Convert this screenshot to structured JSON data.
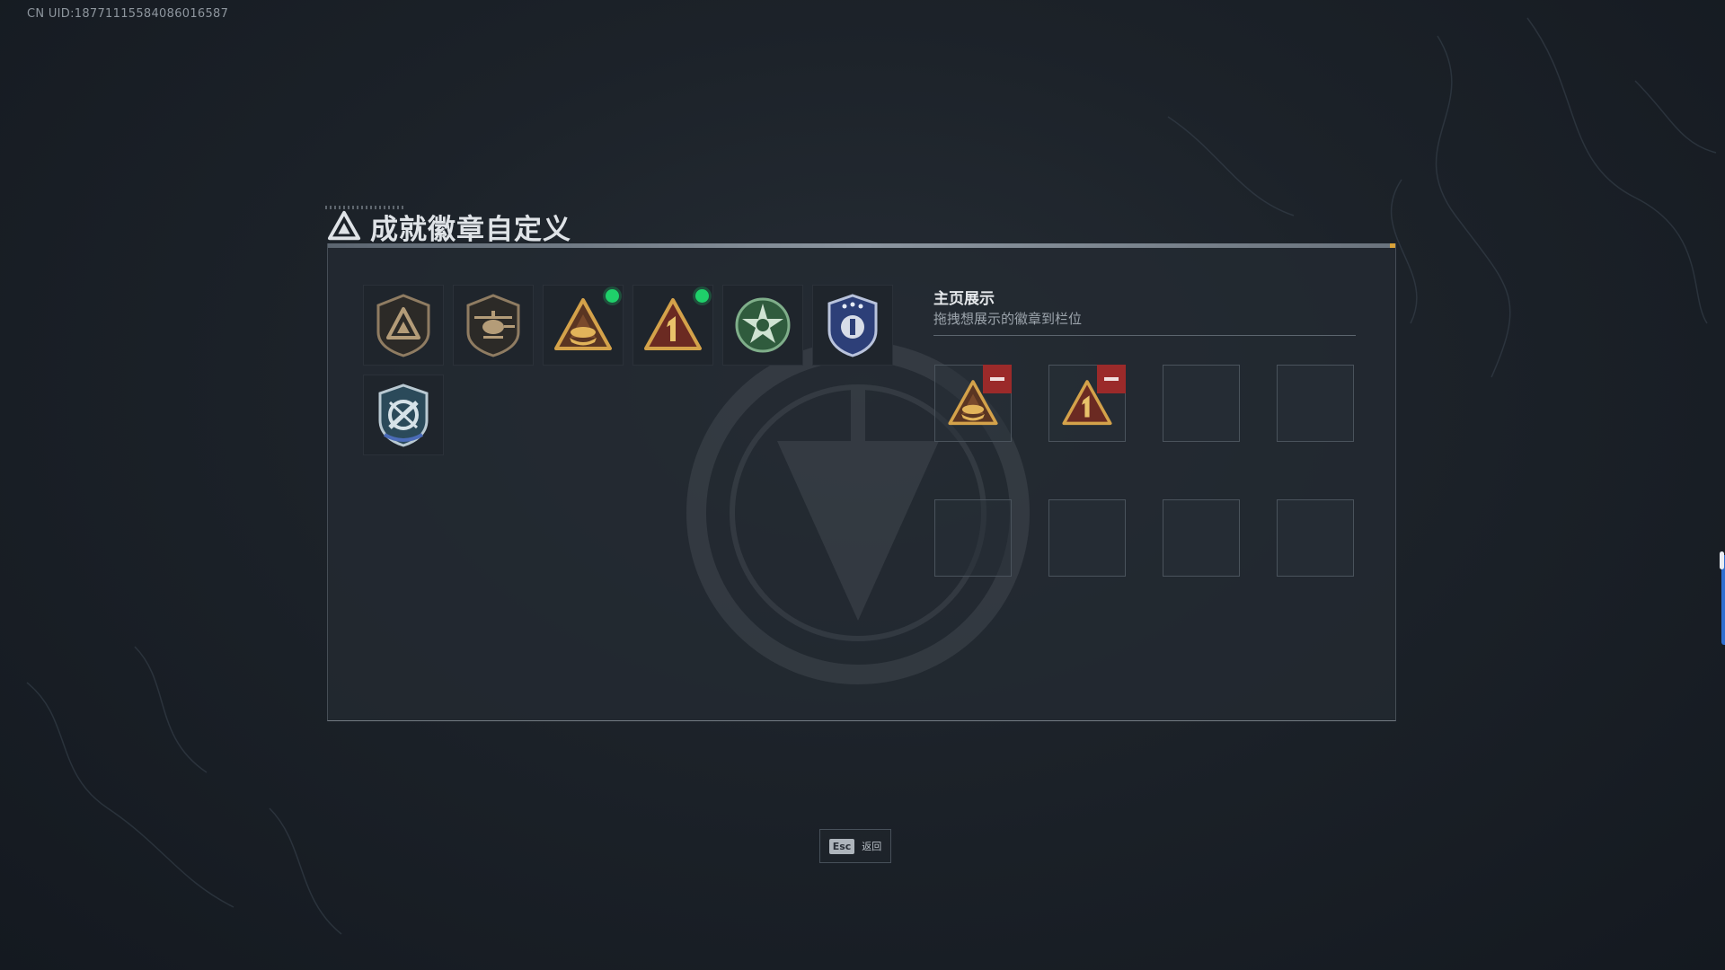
{
  "header": {
    "uid_text": "CN UID:1877111558408601658​7"
  },
  "dialog": {
    "title": "成就徽章自定义",
    "title_icon": "triangle-a-emblem-icon"
  },
  "badges": [
    {
      "icon": "bronze-triangle-shield-badge",
      "new": false
    },
    {
      "icon": "helicopter-shield-badge",
      "new": false
    },
    {
      "icon": "gold-triangle-boat-badge",
      "new": true
    },
    {
      "icon": "gold-triangle-number-one-badge",
      "new": true
    },
    {
      "icon": "green-star-skull-badge",
      "new": false
    },
    {
      "icon": "blue-shield-stars-badge",
      "new": false
    },
    {
      "icon": "teal-shield-crossed-badge",
      "new": false
    }
  ],
  "showcase": {
    "title": "主页展示",
    "subtitle": "拖拽想展示的徽章到栏位",
    "slots": [
      {
        "badge": "gold-triangle-boat-badge"
      },
      {
        "badge": "gold-triangle-number-one-badge"
      },
      {
        "badge": null
      },
      {
        "badge": null
      },
      {
        "badge": null
      },
      {
        "badge": null
      },
      {
        "badge": null
      },
      {
        "badge": null
      }
    ]
  },
  "footer": {
    "esc_key": "Esc",
    "esc_label": "返回"
  },
  "colors": {
    "new_dot": "#1fd06a",
    "remove": "#9b2a2a",
    "accent_bar": "#d8a23a"
  }
}
